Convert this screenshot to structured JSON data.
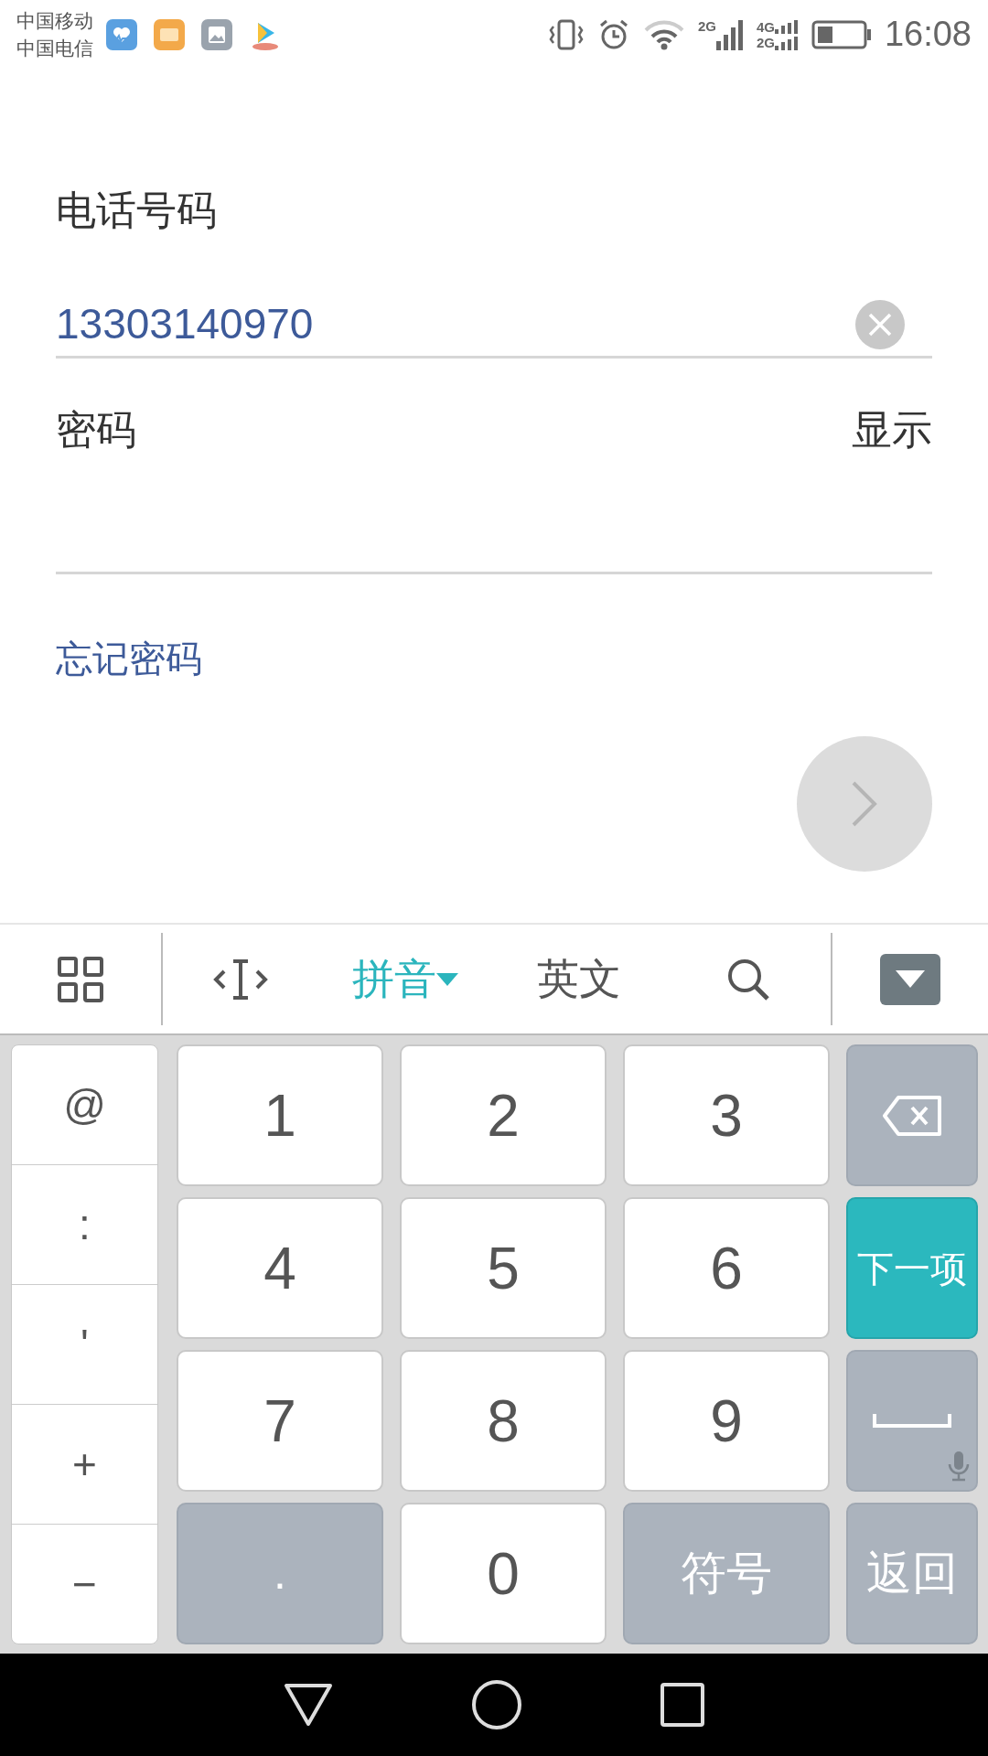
{
  "status_bar": {
    "carriers": [
      "中国移动",
      "中国电信"
    ],
    "network_1": "2G",
    "network_2": "4G",
    "network_3": "2G",
    "time": "16:08"
  },
  "form": {
    "phone_label": "电话号码",
    "phone_value": "13303140970",
    "password_label": "密码",
    "show_toggle": "显示",
    "forgot_link": "忘记密码"
  },
  "keyboard_toolbar": [
    {
      "kind": "grid"
    },
    {
      "kind": "cursor"
    },
    {
      "kind": "mode",
      "label": "拼音",
      "selected": true
    },
    {
      "kind": "mode",
      "label": "英文",
      "selected": false
    },
    {
      "kind": "search"
    },
    {
      "kind": "hide"
    }
  ],
  "symbol_keys": [
    "@",
    ":",
    "'",
    "+",
    "−"
  ],
  "keys": [
    {
      "kind": "digit",
      "label": "1"
    },
    {
      "kind": "digit",
      "label": "2"
    },
    {
      "kind": "digit",
      "label": "3"
    },
    {
      "kind": "backspace"
    },
    {
      "kind": "digit",
      "label": "4"
    },
    {
      "kind": "digit",
      "label": "5"
    },
    {
      "kind": "digit",
      "label": "6"
    },
    {
      "kind": "action",
      "label": "下一项"
    },
    {
      "kind": "digit",
      "label": "7"
    },
    {
      "kind": "digit",
      "label": "8"
    },
    {
      "kind": "digit",
      "label": "9"
    },
    {
      "kind": "space"
    },
    {
      "kind": "func",
      "label": "."
    },
    {
      "kind": "digit",
      "label": "0"
    },
    {
      "kind": "func",
      "label": "符号"
    },
    {
      "kind": "func",
      "label": "返回"
    }
  ]
}
